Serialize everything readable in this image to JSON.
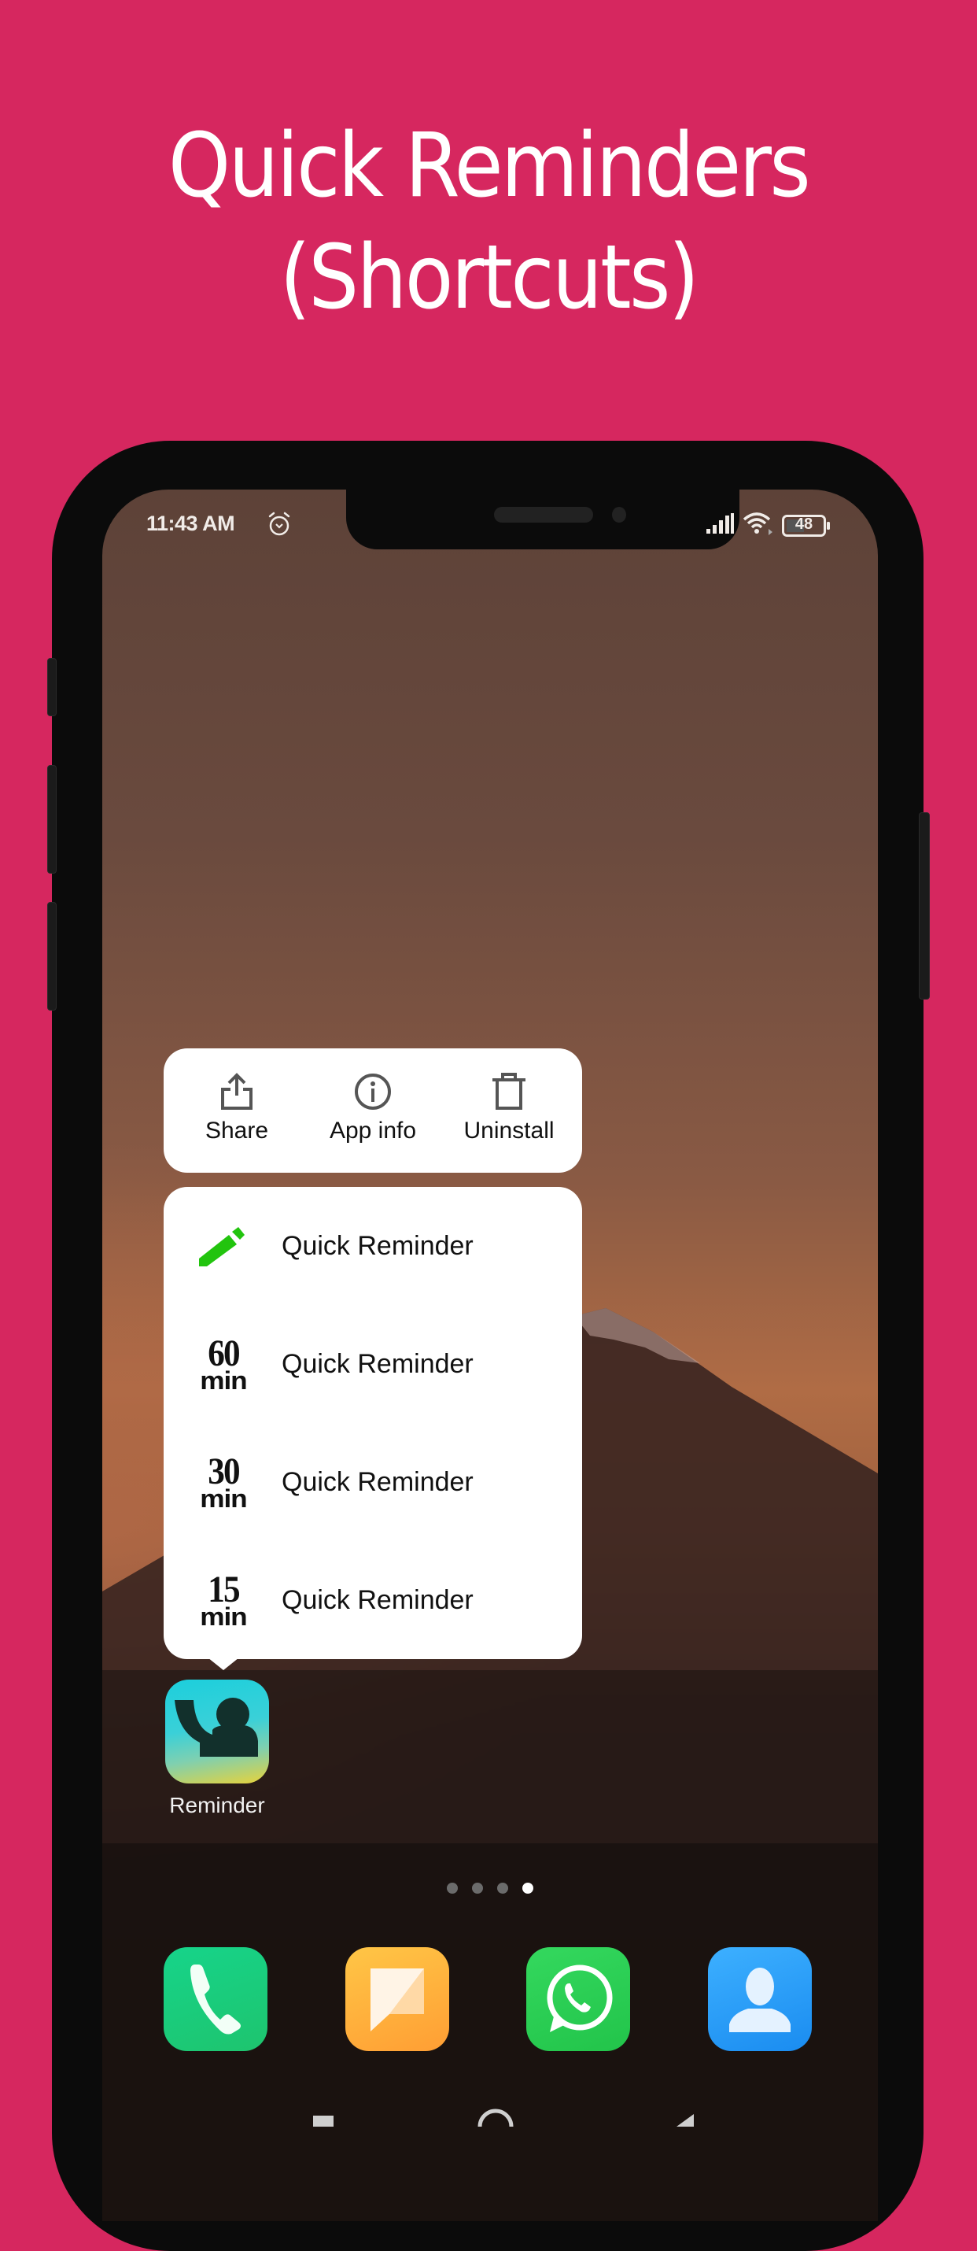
{
  "headline": {
    "line1": "Quick Reminders",
    "line2": "(Shortcuts)"
  },
  "status_bar": {
    "time": "11:43 AM",
    "alarm_icon": "alarm-clock-icon",
    "signal_icon": "cellular-signal-icon",
    "wifi_icon": "wifi-icon",
    "battery_level": "48"
  },
  "popup": {
    "actions": [
      {
        "label": "Share",
        "icon": "share-icon"
      },
      {
        "label": "App info",
        "icon": "info-icon"
      },
      {
        "label": "Uninstall",
        "icon": "trash-icon"
      }
    ],
    "shortcuts": [
      {
        "label": "Quick Reminder",
        "icon": "pencil-icon",
        "icon_color": "#22c40e"
      },
      {
        "label": "Quick Reminder",
        "icon": "60-min-icon",
        "num": "60",
        "unit": "min"
      },
      {
        "label": "Quick Reminder",
        "icon": "30-min-icon",
        "num": "30",
        "unit": "min"
      },
      {
        "label": "Quick Reminder",
        "icon": "15-min-icon",
        "num": "15",
        "unit": "min"
      }
    ]
  },
  "home": {
    "app": {
      "label": "Reminder",
      "icon": "reminder-app-icon"
    },
    "page_indicator": {
      "pages": 4,
      "current": 4
    },
    "dock": [
      {
        "name": "Phone",
        "icon": "phone-icon",
        "color": "#1fd27a"
      },
      {
        "name": "Messages",
        "icon": "messages-icon",
        "color": "#ffa83a"
      },
      {
        "name": "WhatsApp",
        "icon": "whatsapp-icon",
        "color": "#2bcb4f"
      },
      {
        "name": "Contacts",
        "icon": "contacts-icon",
        "color": "#2b9bff"
      }
    ]
  },
  "colors": {
    "background": "#d6275f",
    "popup_bg": "#ffffff",
    "pencil_green": "#22c40e"
  }
}
